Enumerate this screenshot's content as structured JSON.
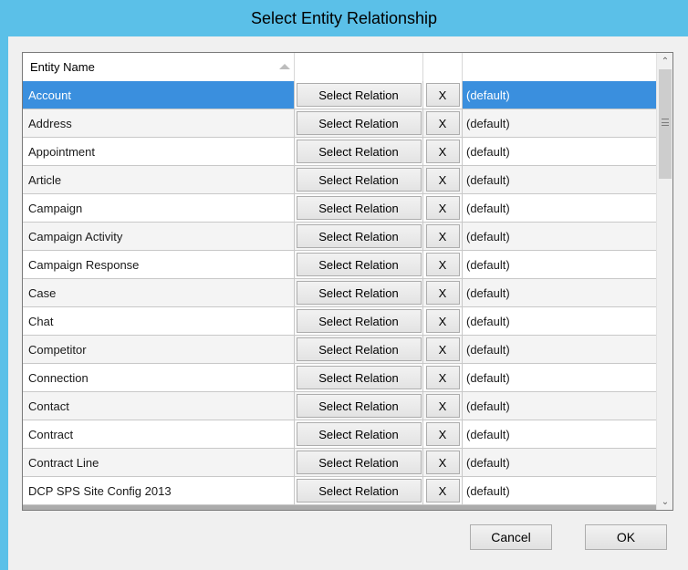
{
  "window": {
    "title": "Select Entity Relationship"
  },
  "grid": {
    "columns": [
      {
        "label": "Entity Name"
      },
      {
        "label": ""
      },
      {
        "label": ""
      },
      {
        "label": ""
      }
    ],
    "select_label": "Select Relation",
    "clear_label": "X",
    "rows": [
      {
        "name": "Account",
        "relation": "(default)"
      },
      {
        "name": "Address",
        "relation": "(default)"
      },
      {
        "name": "Appointment",
        "relation": "(default)"
      },
      {
        "name": "Article",
        "relation": "(default)"
      },
      {
        "name": "Campaign",
        "relation": "(default)"
      },
      {
        "name": "Campaign Activity",
        "relation": "(default)"
      },
      {
        "name": "Campaign Response",
        "relation": "(default)"
      },
      {
        "name": "Case",
        "relation": "(default)"
      },
      {
        "name": "Chat",
        "relation": "(default)"
      },
      {
        "name": "Competitor",
        "relation": "(default)"
      },
      {
        "name": "Connection",
        "relation": "(default)"
      },
      {
        "name": "Contact",
        "relation": "(default)"
      },
      {
        "name": "Contract",
        "relation": "(default)"
      },
      {
        "name": "Contract Line",
        "relation": "(default)"
      },
      {
        "name": "DCP SPS Site Config 2013",
        "relation": "(default)"
      }
    ],
    "selected_index": 0
  },
  "scrollbar": {
    "up_glyph": "^",
    "down_glyph": "v"
  },
  "buttons": {
    "cancel": "Cancel",
    "ok": "OK"
  },
  "colors": {
    "title_bar": "#5bc0e8",
    "selection": "#3a8fde"
  }
}
